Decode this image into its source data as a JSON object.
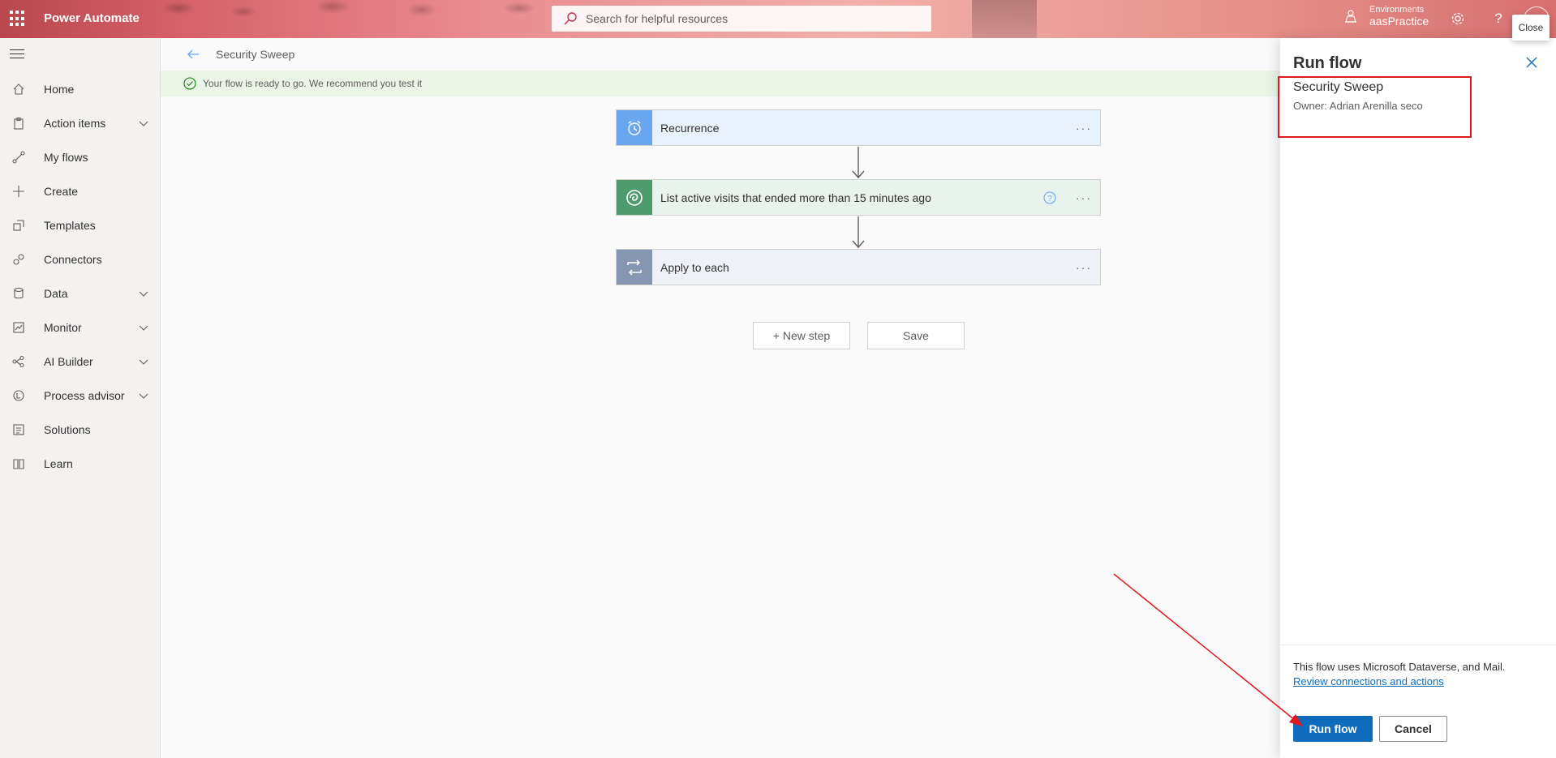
{
  "header": {
    "app_title": "Power Automate",
    "search_placeholder": "Search for helpful resources",
    "env_label": "Environments",
    "env_name": "aasPractice",
    "tooltip": "Close"
  },
  "nav": {
    "items": [
      {
        "label": "Home",
        "icon": "home-icon",
        "chevron": false
      },
      {
        "label": "Action items",
        "icon": "clipboard-icon",
        "chevron": true
      },
      {
        "label": "My flows",
        "icon": "flows-icon",
        "chevron": false
      },
      {
        "label": "Create",
        "icon": "plus-icon",
        "chevron": false
      },
      {
        "label": "Templates",
        "icon": "templates-icon",
        "chevron": false
      },
      {
        "label": "Connectors",
        "icon": "connector-icon",
        "chevron": false
      },
      {
        "label": "Data",
        "icon": "database-icon",
        "chevron": true
      },
      {
        "label": "Monitor",
        "icon": "monitor-icon",
        "chevron": true
      },
      {
        "label": "AI Builder",
        "icon": "ai-icon",
        "chevron": true
      },
      {
        "label": "Process advisor",
        "icon": "process-icon",
        "chevron": true
      },
      {
        "label": "Solutions",
        "icon": "solutions-icon",
        "chevron": false
      },
      {
        "label": "Learn",
        "icon": "book-icon",
        "chevron": false
      }
    ]
  },
  "main": {
    "flow_name": "Security Sweep",
    "banner": "Your flow is ready to go. We recommend you test it",
    "steps": [
      {
        "title": "Recurrence",
        "icon": "alarm-clock-icon",
        "color": "#6aa7f0",
        "bg": "#e8f2fc"
      },
      {
        "title": "List active visits that ended more than 15 minutes ago",
        "icon": "dataverse-icon",
        "color": "#4f9b6d",
        "bg": "#e7f3ec"
      },
      {
        "title": "Apply to each",
        "icon": "loop-icon",
        "color": "#8596b0",
        "bg": "#eef1f5"
      }
    ],
    "new_step_label": "+ New step",
    "save_label": "Save"
  },
  "panel": {
    "title": "Run flow",
    "flow_name": "Security Sweep",
    "owner": "Owner: Adrian Arenilla seco",
    "note": "This flow uses Microsoft Dataverse, and Mail.",
    "link": "Review connections and actions",
    "run_label": "Run flow",
    "cancel_label": "Cancel"
  },
  "colors": {
    "accent": "#0f6cbd",
    "annotation": "#e0191f"
  }
}
